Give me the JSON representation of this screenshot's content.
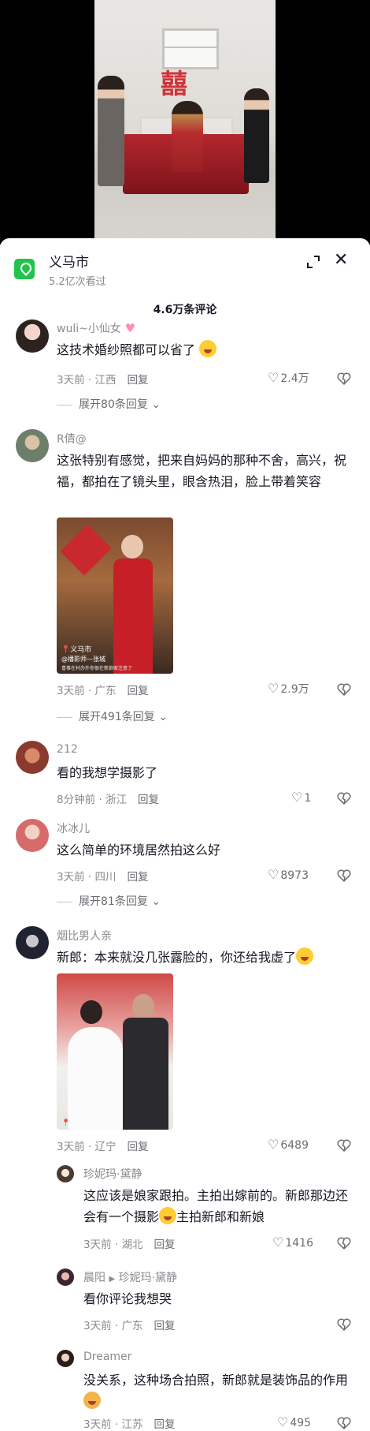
{
  "header": {
    "location_title": "义马市",
    "views": "5.2亿次看过",
    "comment_count": "4.6万条评论",
    "close_glyph": "✕"
  },
  "comments": [
    {
      "user": "wuli~小仙女",
      "text": "这技术婚纱照都可以省了",
      "time": "3天前",
      "region": "江西",
      "reply": "回复",
      "likes": "2.4万",
      "expand": "展开80条回复"
    },
    {
      "user": "R倩@",
      "text": "这张特别有感觉，把来自妈妈的那种不舍，高兴，祝福，都拍在了镜头里，眼含热泪，脸上带着笑容",
      "time": "3天前",
      "region": "广东",
      "reply": "回复",
      "likes": "2.9万",
      "expand": "展开491条回复",
      "image_watermark": "义马市",
      "image_caption": "@播影师—张城",
      "image_subcaption": "喜事在村办外你很在新娘家注意了"
    },
    {
      "user": "212",
      "text": "看的我想学摄影了",
      "time": "8分钟前",
      "region": "浙江",
      "reply": "回复",
      "likes": "1"
    },
    {
      "user": "冰冰儿",
      "text": "这么简单的环境居然拍这么好",
      "time": "3天前",
      "region": "四川",
      "reply": "回复",
      "likes": "8973",
      "expand": "展开81条回复"
    },
    {
      "user": "烟比男人亲",
      "text": "新郎：本来就没几张露脸的，你还给我虚了",
      "time": "3天前",
      "region": "辽宁",
      "reply": "回复",
      "likes": "6489",
      "image_watermark": "义马市"
    }
  ],
  "replies": [
    {
      "user": "珍妮玛·黛静",
      "text_part1": "这应该是娘家跟拍。主拍出嫁前的。新郎那边还会有一个摄影",
      "text_part2": "主拍新郎和新娘",
      "time": "3天前",
      "region": "湖北",
      "reply": "回复",
      "likes": "1416"
    },
    {
      "user": "晨阳",
      "reply_to": "珍妮玛·黛静",
      "text": "看你评论我想哭",
      "time": "3天前",
      "region": "广东",
      "reply": "回复"
    },
    {
      "user": "Dreamer",
      "text": "没关系，这种场合拍照，新郎就是装饰品的作用",
      "time": "3天前",
      "region": "江苏",
      "reply": "回复",
      "likes": "495"
    }
  ],
  "icons": {
    "location": "location-pin-icon",
    "expand": "expand-corners-icon",
    "close": "close-icon",
    "like": "heart-icon",
    "dislike": "broken-heart-icon",
    "chevron": "chevron-down-icon"
  },
  "colors": {
    "location_green": "#22c24c",
    "text_primary": "#161823",
    "text_secondary": "#8a8b91"
  }
}
